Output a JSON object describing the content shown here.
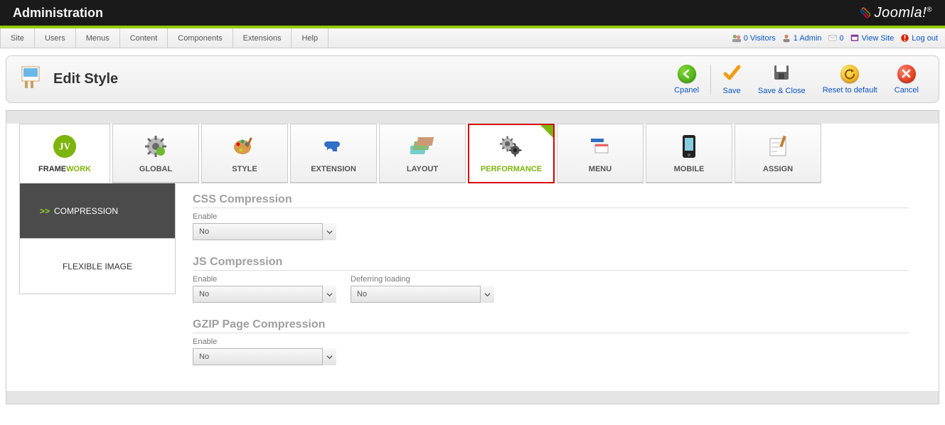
{
  "topbar": {
    "title": "Administration",
    "brand": "Joomla!"
  },
  "menu": {
    "items": [
      "Site",
      "Users",
      "Menus",
      "Content",
      "Components",
      "Extensions",
      "Help"
    ],
    "status": {
      "visitors": "0 Visitors",
      "admin": "1 Admin",
      "mail": "0",
      "view_site": "View Site",
      "logout": "Log out"
    }
  },
  "toolbar": {
    "page_title": "Edit Style",
    "buttons": {
      "cpanel": "Cpanel",
      "save": "Save",
      "save_close": "Save & Close",
      "reset": "Reset to default",
      "cancel": "Cancel"
    }
  },
  "tabs": {
    "framework": {
      "label_frame": "FRAME",
      "label_work": "WORK"
    },
    "items": [
      {
        "id": "global",
        "label": "GLOBAL"
      },
      {
        "id": "style",
        "label": "STYLE"
      },
      {
        "id": "extension",
        "label": "EXTENSION"
      },
      {
        "id": "layout",
        "label": "LAYOUT"
      },
      {
        "id": "performance",
        "label": "PERFORMANCE",
        "active": true
      },
      {
        "id": "menu",
        "label": "MENU"
      },
      {
        "id": "mobile",
        "label": "MOBILE"
      },
      {
        "id": "assign",
        "label": "ASSIGN"
      }
    ]
  },
  "sidebar": {
    "items": [
      {
        "label": "COMPRESSION",
        "active": true
      },
      {
        "label": "FLEXIBLE IMAGE"
      }
    ]
  },
  "sections": {
    "css": {
      "title": "CSS Compression",
      "enable_label": "Enable",
      "enable_value": "No"
    },
    "js": {
      "title": "JS Compression",
      "enable_label": "Enable",
      "enable_value": "No",
      "deferring_label": "Deferring loading",
      "deferring_value": "No"
    },
    "gzip": {
      "title": "GZIP Page Compression",
      "enable_label": "Enable",
      "enable_value": "No"
    }
  }
}
